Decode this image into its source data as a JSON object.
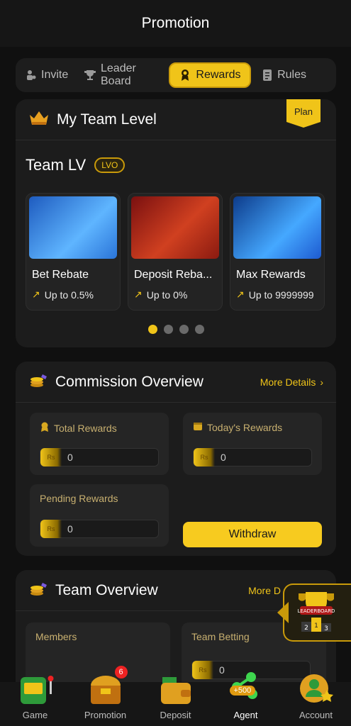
{
  "header": {
    "title": "Promotion"
  },
  "tabs": [
    {
      "label": "Invite",
      "icon": "person-icon"
    },
    {
      "label": "Leader Board",
      "icon": "trophy-icon"
    },
    {
      "label": "Rewards",
      "icon": "medal-icon",
      "active": true
    },
    {
      "label": "Rules",
      "icon": "document-icon"
    }
  ],
  "team_level": {
    "title": "My Team Level",
    "plan_badge": "Plan",
    "team_lv_label": "Team LV",
    "level_pill": "LVO",
    "cards": [
      {
        "name": "Bet Rebate",
        "upto": "Up to 0.5%"
      },
      {
        "name": "Deposit Reba...",
        "upto": "Up to 0%"
      },
      {
        "name": "Max Rewards",
        "upto": "Up to 9999999"
      }
    ],
    "carousel_page": 1,
    "carousel_total": 4
  },
  "commission": {
    "title": "Commission Overview",
    "more": "More Details",
    "total_rewards_label": "Total Rewards",
    "total_rewards_value": "0",
    "todays_rewards_label": "Today's Rewards",
    "todays_rewards_value": "0",
    "pending_rewards_label": "Pending Rewards",
    "pending_rewards_value": "0",
    "currency_symbol": "Rs",
    "withdraw_label": "Withdraw"
  },
  "team_overview": {
    "title": "Team Overview",
    "more": "More D",
    "members_label": "Members",
    "team_betting_label": "Team Betting",
    "team_betting_value": "0"
  },
  "leaderboard_float": {
    "label": "LEADERBOARD",
    "ranks": [
      "2",
      "1",
      "3"
    ]
  },
  "bottom_nav": [
    {
      "label": "Game"
    },
    {
      "label": "Promotion",
      "badge": "6"
    },
    {
      "label": "Deposit"
    },
    {
      "label": "Agent",
      "bonus": "+500",
      "active": true
    },
    {
      "label": "Account"
    }
  ],
  "colors": {
    "accent": "#f0c419",
    "background": "#101010",
    "card": "#1c1c1c"
  }
}
